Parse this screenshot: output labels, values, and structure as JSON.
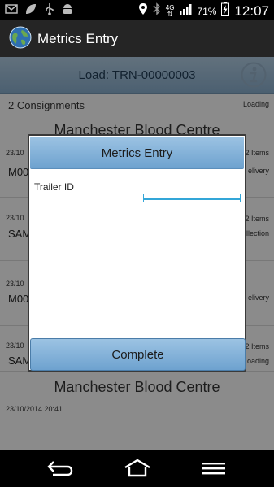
{
  "status_bar": {
    "battery_percent": "71%",
    "time": "12:07",
    "network": "4G",
    "icons": [
      "mail-icon",
      "leaf-icon",
      "usb-icon",
      "android-icon",
      "location-icon",
      "bluetooth-icon",
      "network-4g-icon",
      "signal-icon",
      "battery-charging-icon"
    ]
  },
  "action_bar": {
    "title": "Metrics Entry",
    "icon": "globe-icon"
  },
  "load_bar": {
    "text": "Load: TRN-00000003",
    "icon": "info-icon"
  },
  "list": {
    "count_label": "2 Consignments",
    "status_top": "Loading",
    "rows": [
      {
        "title": "Manchester Blood Centre",
        "date": "23/10",
        "code": "M00",
        "items": "2 Items",
        "status": "elivery"
      },
      {
        "date": "23/10",
        "code": "SAM",
        "items": "2 Items",
        "status": "llection"
      },
      {
        "date": "23/10",
        "code": "M00",
        "status": "elivery"
      },
      {
        "date": "23/10",
        "code": "SAM",
        "items": "2 Items",
        "status": "oading"
      },
      {
        "title": "Manchester Blood Centre",
        "date": "23/10/2014 20:41"
      }
    ]
  },
  "dialog": {
    "title": "Metrics Entry",
    "field_label": "Trailer ID",
    "field_value": "",
    "field_placeholder": "",
    "button_label": "Complete"
  },
  "nav_bar": {
    "icons": [
      "back-icon",
      "home-icon",
      "menu-icon"
    ]
  },
  "colors": {
    "accent": "#33a6d8",
    "header_blue": "#7fb0d8",
    "action_bar": "#252525"
  }
}
